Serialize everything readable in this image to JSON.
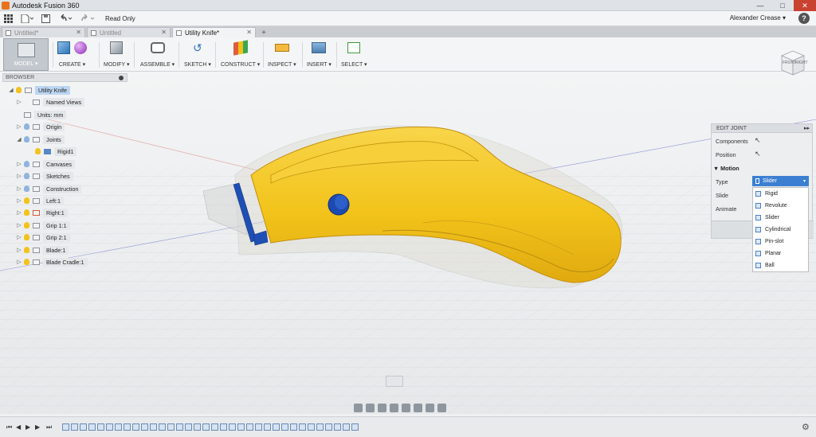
{
  "window": {
    "title": "Autodesk Fusion 360",
    "minimize": "—",
    "maximize": "□",
    "close": "✕"
  },
  "qat": {
    "read_only": "Read Only",
    "user": "Alexander Crease ▾",
    "help": "?"
  },
  "tabs": [
    {
      "label": "Untitled*"
    },
    {
      "label": "Untitled"
    },
    {
      "label": "Utility Knife*"
    }
  ],
  "ribbon": {
    "model": "MODEL ▾",
    "create": "CREATE ▾",
    "modify": "MODIFY ▾",
    "assemble": "ASSEMBLE ▾",
    "sketch": "SKETCH ▾",
    "construct": "CONSTRUCT ▾",
    "inspect": "INSPECT ▾",
    "insert": "INSERT ▾",
    "select": "SELECT ▾"
  },
  "browser": {
    "title": "BROWSER",
    "items": [
      {
        "label": "Utility Knife",
        "level": 0,
        "toggle": "◢"
      },
      {
        "label": "Named Views",
        "level": 1,
        "toggle": "▷"
      },
      {
        "label": "Units: mm",
        "level": 1,
        "toggle": ""
      },
      {
        "label": "Origin",
        "level": 1,
        "toggle": "▷"
      },
      {
        "label": "Joints",
        "level": 1,
        "toggle": "◢"
      },
      {
        "label": "Rigid1",
        "level": 2,
        "toggle": ""
      },
      {
        "label": "Canvases",
        "level": 1,
        "toggle": "▷"
      },
      {
        "label": "Sketches",
        "level": 1,
        "toggle": "▷"
      },
      {
        "label": "Construction",
        "level": 1,
        "toggle": "▷"
      },
      {
        "label": "Left:1",
        "level": 1,
        "toggle": "▷"
      },
      {
        "label": "Right:1",
        "level": 1,
        "toggle": "▷"
      },
      {
        "label": "Grip 1:1",
        "level": 1,
        "toggle": "▷"
      },
      {
        "label": "Grip 2:1",
        "level": 1,
        "toggle": "▷"
      },
      {
        "label": "Blade:1",
        "level": 1,
        "toggle": "▷"
      },
      {
        "label": "Blade Cradle:1",
        "level": 1,
        "toggle": "▷"
      }
    ]
  },
  "edit_joint": {
    "title": "EDIT JOINT",
    "expand": "▸▸",
    "components": "Components",
    "position": "Position",
    "motion": "▼ Motion",
    "type": "Type",
    "slide": "Slide",
    "animate": "Animate",
    "type_value": "Slider",
    "type_caret": "▾",
    "options": [
      "Rigid",
      "Revolute",
      "Slider",
      "Cylindrical",
      "Pin-slot",
      "Planar",
      "Ball"
    ]
  },
  "viewcube": {
    "front": "FRONT",
    "right": "RIGHT"
  },
  "colors": {
    "knife_body": "#f2c31a",
    "knife_edge": "#c4900e",
    "blade_holder": "#1f4fb5",
    "dropdown_accent": "#3b7fd1"
  }
}
